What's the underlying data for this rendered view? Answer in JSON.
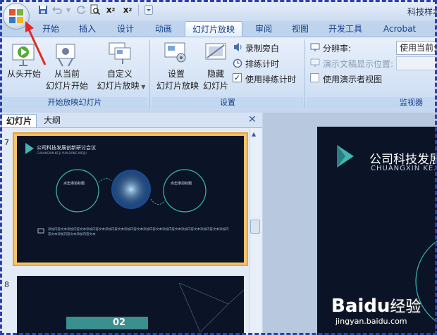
{
  "window": {
    "title": "科技样本"
  },
  "qat": {
    "undo_icon": "undo-icon",
    "redo_icon": "redo-icon"
  },
  "tabs": [
    {
      "label": "开始"
    },
    {
      "label": "插入"
    },
    {
      "label": "设计"
    },
    {
      "label": "动画"
    },
    {
      "label": "幻灯片放映"
    },
    {
      "label": "审阅"
    },
    {
      "label": "视图"
    },
    {
      "label": "开发工具"
    },
    {
      "label": "Acrobat"
    }
  ],
  "ribbon": {
    "start_group": {
      "caption": "开始放映幻灯片",
      "from_beginning": "从头开始",
      "from_current_l1": "从当前",
      "from_current_l2": "幻灯片开始",
      "custom_l1": "自定义",
      "custom_l2": "幻灯片放映"
    },
    "setup_group": {
      "caption": "设置",
      "setup_l1": "设置",
      "setup_l2": "幻灯片放映",
      "hide_l1": "隐藏",
      "hide_l2": "幻灯片",
      "record_narration": "录制旁白",
      "rehearse_timings": "排练计时",
      "use_rehearsed": "使用排练计时"
    },
    "monitor_group": {
      "caption": "监视器",
      "resolution_label": "分辨率:",
      "resolution_value": "使用当前分",
      "show_on_label": "演示文稿显示位置:",
      "presenter_view": "使用演示者视图"
    }
  },
  "panel": {
    "tabs": [
      "幻灯片",
      "大纲"
    ],
    "close": "✕",
    "slide7": {
      "num": "7",
      "title": "公司科技发展创新研讨会议",
      "subtitle": "CHUANGXIN KE JI YUN DONG WEIJU",
      "left_circle": "点击添加标题",
      "right_circle": "点击添加标题",
      "body": "添加内容文本添加内容文本添加内容文本添加内容文本添加内容文本添加内容文本添加内容文本添加内容文本添加内容文本添加内容文本添加内容文本添加内容文本"
    },
    "slide8": {
      "num": "8",
      "number_text": "02"
    }
  },
  "main_slide": {
    "title": "公司科技发展",
    "subtitle": "CHUANGXIN KE..."
  },
  "watermark": {
    "brand": "Baidu",
    "sub": "经验",
    "url": "jingyan.baidu.com"
  },
  "colors": {
    "accent": "#15428b",
    "slide_bg": "#0b1426",
    "teal": "#3fb6b0",
    "selection": "#f6c56a"
  }
}
